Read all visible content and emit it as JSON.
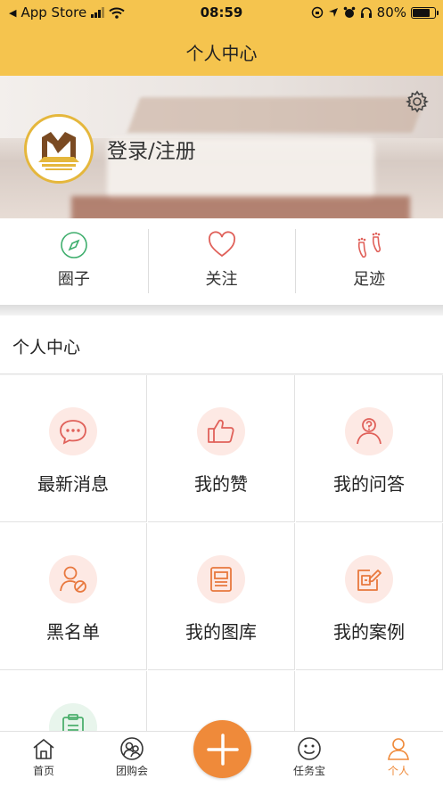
{
  "status": {
    "carrier": "App Store",
    "time": "08:59",
    "battery": "80%",
    "battery_level": 0.8
  },
  "header": {
    "title": "个人中心"
  },
  "profile": {
    "login_label": "登录/注册"
  },
  "quick_actions": [
    {
      "label": "圈子",
      "icon": "compass-icon"
    },
    {
      "label": "关注",
      "icon": "heart-icon"
    },
    {
      "label": "足迹",
      "icon": "footprints-icon"
    }
  ],
  "section": {
    "title": "个人中心"
  },
  "grid": [
    {
      "label": "最新消息",
      "icon": "message-icon"
    },
    {
      "label": "我的赞",
      "icon": "thumbs-up-icon"
    },
    {
      "label": "我的问答",
      "icon": "question-user-icon"
    },
    {
      "label": "黑名单",
      "icon": "blocked-user-icon"
    },
    {
      "label": "我的图库",
      "icon": "gallery-icon"
    },
    {
      "label": "我的案例",
      "icon": "case-icon"
    },
    {
      "label": "",
      "icon": "clipboard-icon"
    }
  ],
  "tabbar": [
    {
      "label": "首页",
      "icon": "home-icon"
    },
    {
      "label": "团购会",
      "icon": "group-buy-icon"
    },
    {
      "label": "任务宝",
      "icon": "smile-icon"
    },
    {
      "label": "个人",
      "icon": "user-icon"
    }
  ],
  "colors": {
    "accent": "#f5c44e",
    "tab_active": "#ef8a3a",
    "icon_red": "#e0615a",
    "icon_orange": "#e8783e"
  }
}
